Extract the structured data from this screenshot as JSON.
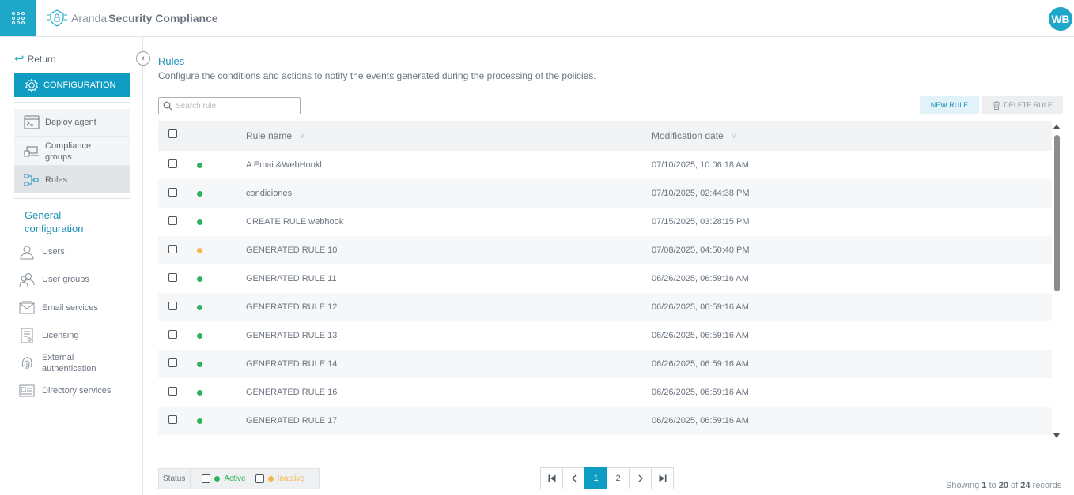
{
  "header": {
    "brand_light": "Aranda",
    "brand_bold": "Security Compliance",
    "avatar_initials": "WB",
    "accent_color": "#1ea7c9"
  },
  "sidebar": {
    "return_label": "Return",
    "config_label": "CONFIGURATION",
    "items": [
      {
        "label": "Deploy agent",
        "icon": "terminal-window-icon"
      },
      {
        "label": "Compliance groups",
        "icon": "devices-group-icon"
      },
      {
        "label": "Rules",
        "icon": "rules-flow-icon",
        "active": true
      }
    ],
    "general_title": "General configuration",
    "general_items": [
      {
        "label": "Users",
        "icon": "user-icon"
      },
      {
        "label": "User groups",
        "icon": "user-group-icon"
      },
      {
        "label": "Email services",
        "icon": "email-icon"
      },
      {
        "label": "Licensing",
        "icon": "license-doc-icon"
      },
      {
        "label": "External authentication",
        "icon": "fingerprint-icon"
      },
      {
        "label": "Directory services",
        "icon": "directory-card-icon"
      }
    ]
  },
  "main": {
    "title": "Rules",
    "description": "Configure the conditions and actions to notify the events generated during the processing of the policies.",
    "search_placeholder": "Search rule",
    "new_rule_label": "NEW RULE",
    "delete_rule_label": "DELETE RULE",
    "columns": {
      "name": "Rule name",
      "date": "Modification date"
    },
    "rows": [
      {
        "name": "A Emai &WebHookl",
        "date": "07/10/2025, 10:06:18 AM",
        "status": "active"
      },
      {
        "name": "condiciones",
        "date": "07/10/2025, 02:44:38 PM",
        "status": "active"
      },
      {
        "name": "CREATE RULE webhook",
        "date": "07/15/2025, 03:28:15 PM",
        "status": "active"
      },
      {
        "name": "GENERATED RULE 10",
        "date": "07/08/2025, 04:50:40 PM",
        "status": "inactive"
      },
      {
        "name": "GENERATED RULE 11",
        "date": "06/26/2025, 06:59:16 AM",
        "status": "active"
      },
      {
        "name": "GENERATED RULE 12",
        "date": "06/26/2025, 06:59:16 AM",
        "status": "active"
      },
      {
        "name": "GENERATED RULE 13",
        "date": "06/26/2025, 06:59:16 AM",
        "status": "active"
      },
      {
        "name": "GENERATED RULE 14",
        "date": "06/26/2025, 06:59:16 AM",
        "status": "active"
      },
      {
        "name": "GENERATED RULE 16",
        "date": "06/26/2025, 06:59:16 AM",
        "status": "active"
      },
      {
        "name": "GENERATED RULE 17",
        "date": "06/26/2025, 06:59:16 AM",
        "status": "active"
      }
    ],
    "status_colors": {
      "active": "#2db35b",
      "inactive": "#f4b74e"
    }
  },
  "footer": {
    "status_label": "Status",
    "active_label": "Active",
    "inactive_label": "Inactive",
    "pages": [
      "1",
      "2"
    ],
    "current_page": "1",
    "records_prefix": "Showing",
    "records_from": "1",
    "records_to_word": "to",
    "records_to": "20",
    "records_of_word": "of",
    "records_total": "24",
    "records_suffix": "records"
  }
}
